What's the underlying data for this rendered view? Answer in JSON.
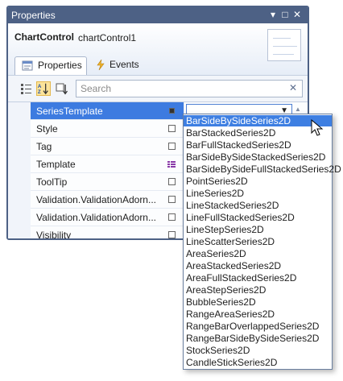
{
  "window": {
    "title": "Properties"
  },
  "header": {
    "object_type": "ChartControl",
    "object_name": "chartControl1"
  },
  "tabs": [
    {
      "label": "Properties"
    },
    {
      "label": "Events"
    }
  ],
  "search": {
    "placeholder": "Search"
  },
  "properties": [
    {
      "name": "SeriesTemplate"
    },
    {
      "name": "Style"
    },
    {
      "name": "Tag"
    },
    {
      "name": "Template"
    },
    {
      "name": "ToolTip"
    },
    {
      "name": "Validation.ValidationAdorn..."
    },
    {
      "name": "Validation.ValidationAdorn..."
    },
    {
      "name": "Visibility"
    }
  ],
  "dropdown": {
    "options": [
      "BarSideBySideSeries2D",
      "BarStackedSeries2D",
      "BarFullStackedSeries2D",
      "BarSideBySideStackedSeries2D",
      "BarSideBySideFullStackedSeries2D",
      "PointSeries2D",
      "LineSeries2D",
      "LineStackedSeries2D",
      "LineFullStackedSeries2D",
      "LineStepSeries2D",
      "LineScatterSeries2D",
      "AreaSeries2D",
      "AreaStackedSeries2D",
      "AreaFullStackedSeries2D",
      "AreaStepSeries2D",
      "BubbleSeries2D",
      "RangeAreaSeries2D",
      "RangeBarOverlappedSeries2D",
      "RangeBarSideBySideSeries2D",
      "StockSeries2D",
      "CandleStickSeries2D"
    ]
  }
}
